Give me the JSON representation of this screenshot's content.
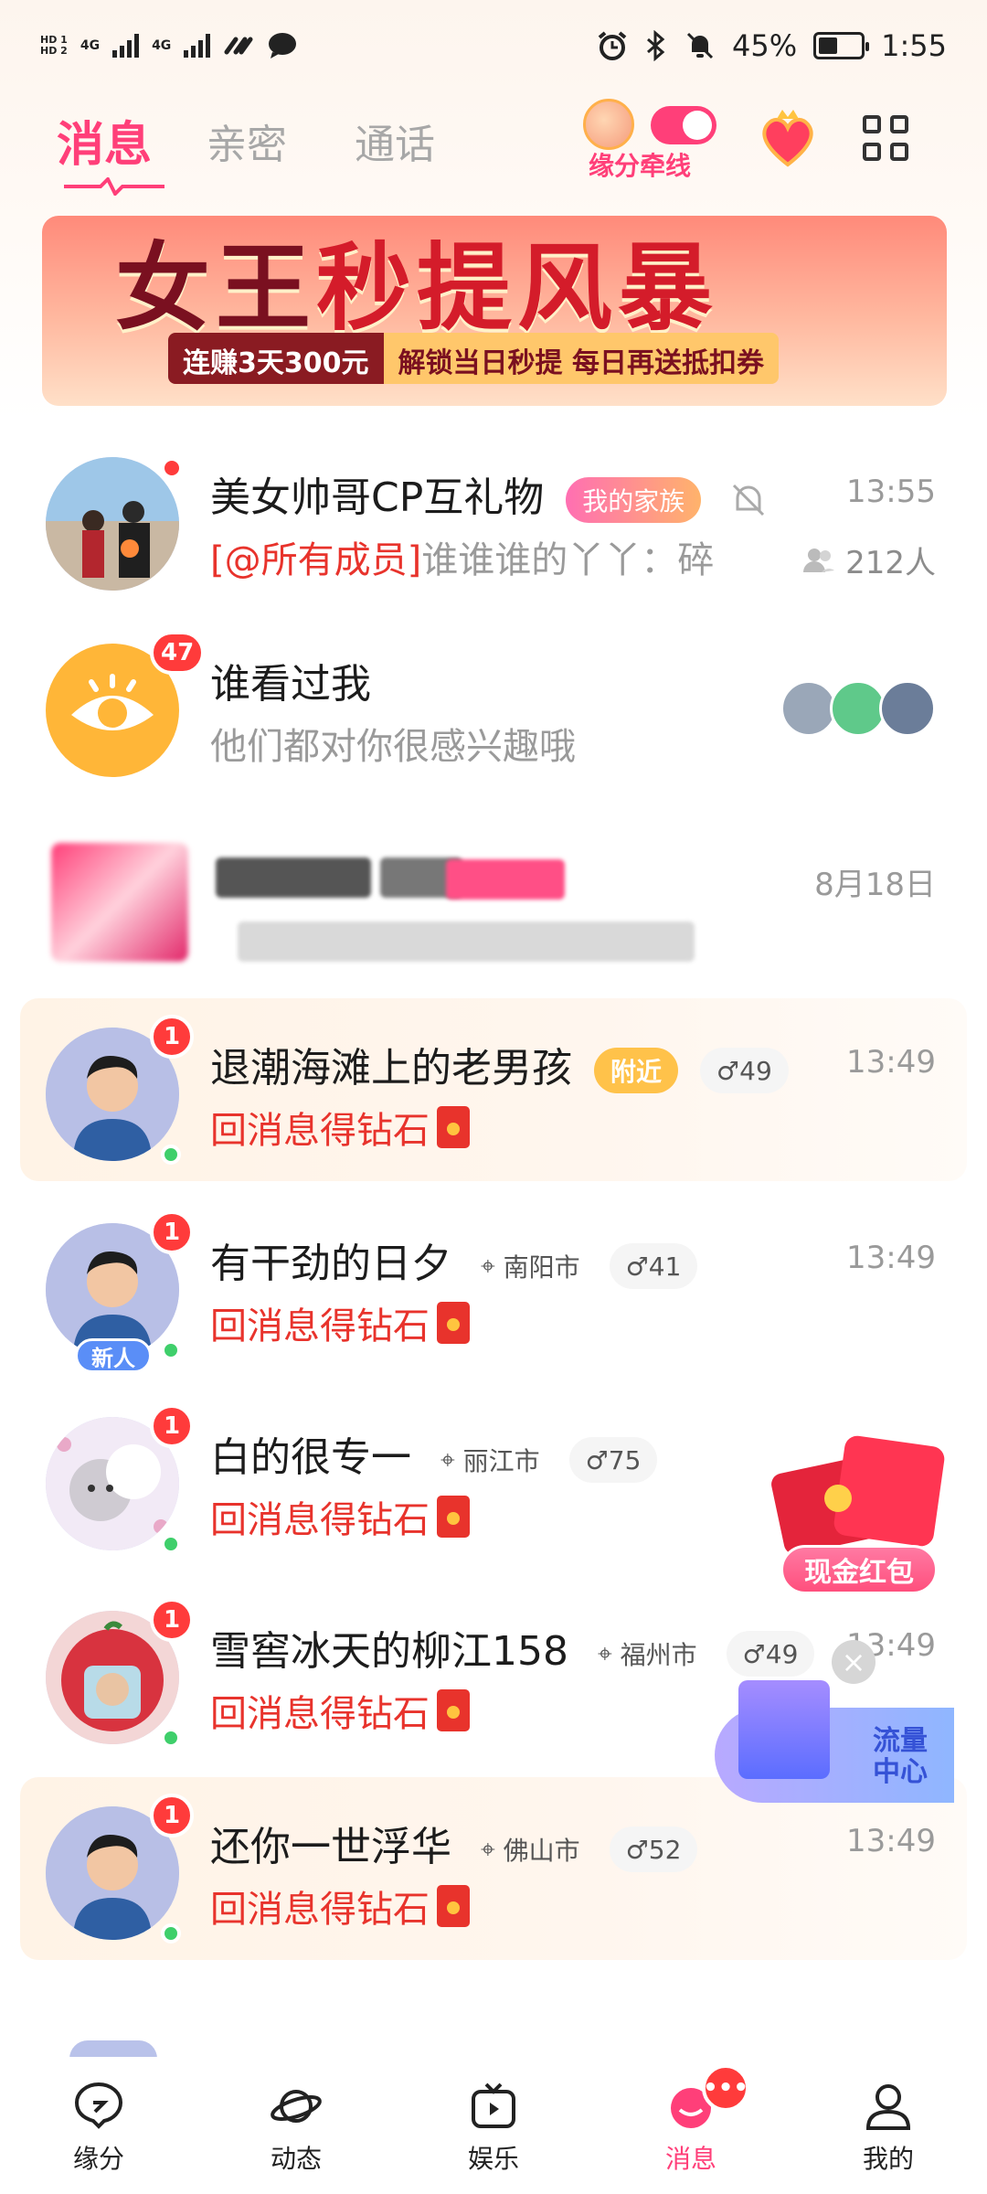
{
  "status_bar": {
    "time": "1:55",
    "battery": "45%",
    "sim1_label": "HD 1",
    "sim2_label": "HD 2",
    "net1": "4G",
    "net2": "4G"
  },
  "header": {
    "tabs": [
      {
        "label": "消息",
        "active": true
      },
      {
        "label": "亲密",
        "active": false
      },
      {
        "label": "通话",
        "active": false
      }
    ],
    "matchmaking_label": "缘分牵线",
    "accent": "#ff3f79"
  },
  "banner": {
    "headline_part1": "女王",
    "headline_part2": "秒提风暴",
    "sub_left": "连赚3天300元",
    "sub_right": "解锁当日秒提 每日再送抵扣券"
  },
  "conversations": [
    {
      "name": "美女帅哥CP互礼物",
      "tag": "我的家族",
      "muted": true,
      "preview_mention": "[@所有成员]",
      "preview_text": "谁谁谁的丫丫：碎",
      "time": "13:55",
      "members": "212人",
      "unread_dot": true
    },
    {
      "name": "谁看过我",
      "preview_text": "他们都对你很感兴趣哦",
      "badge": "47"
    },
    {
      "time": "8月18日"
    },
    {
      "name": "退潮海滩上的老男孩",
      "tag": "附近",
      "age": "49",
      "preview_text": "回消息得钻石",
      "time": "13:49",
      "badge": "1"
    },
    {
      "name": "有干劲的日夕",
      "location": "南阳市",
      "age": "41",
      "preview_text": "回消息得钻石",
      "time": "13:49",
      "badge": "1",
      "newbie": "新人"
    },
    {
      "name": "白的很专一",
      "location": "丽江市",
      "age": "75",
      "preview_text": "回消息得钻石",
      "time": "13:49",
      "badge": "1"
    },
    {
      "name": "雪窖冰天的柳江158",
      "location": "福州市",
      "age": "49",
      "preview_text": "回消息得钻石",
      "time": "13:49",
      "badge": "1"
    },
    {
      "name": "还你一世浮华",
      "location": "佛山市",
      "age": "52",
      "preview_text": "回消息得钻石",
      "time": "13:49",
      "badge": "1"
    }
  ],
  "floating": {
    "cash_label": "现金红包",
    "traffic_label": "流量中心"
  },
  "bottom_nav": [
    {
      "label": "缘分",
      "icon": "heart-bubble-icon"
    },
    {
      "label": "动态",
      "icon": "planet-icon"
    },
    {
      "label": "娱乐",
      "icon": "tv-play-icon"
    },
    {
      "label": "消息",
      "icon": "chat-icon",
      "active": true
    },
    {
      "label": "我的",
      "icon": "user-icon"
    }
  ]
}
